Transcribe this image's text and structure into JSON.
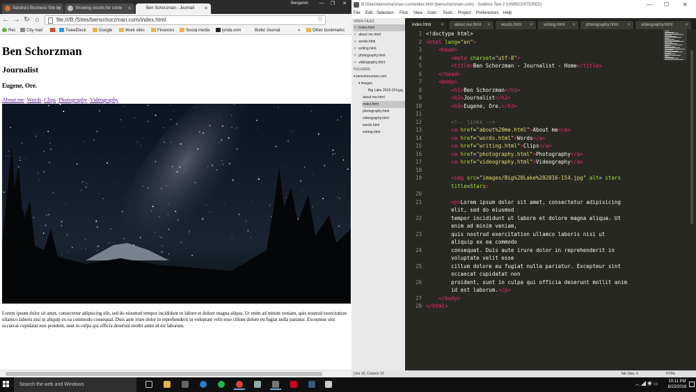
{
  "chrome": {
    "tabs": [
      {
        "label": "Sandra's Business Site by"
      },
      {
        "label": "Showing results for conte"
      },
      {
        "label": "Ben Schorzman - Journali"
      }
    ],
    "user": "Benjamin",
    "address": "file:///B:/Sites/benschorzman.com/index.html",
    "bookmarks": [
      "Rec",
      "City mail",
      "TweetDeck",
      "Google",
      "Work sites",
      "Finances",
      "Social media",
      "lynda.com",
      "Bullet Journal",
      "Other bookmarks"
    ]
  },
  "site": {
    "h1": "Ben Schorzman",
    "h2": "Journalist",
    "h3": "Eugene, Ore.",
    "links": [
      "About me",
      "Words",
      "Clips",
      "Photography",
      "Videography"
    ],
    "paragraph": "Lorem ipsum dolor sit amet, consectetur adipiscing elit, sed do eiusmod tempor incididunt ut labore et dolore magna aliqua. Ut enim ad minim veniam, quis nostrud exercitation ullamco laboris nisi ut aliquip ex ea commodo consequat. Duis aute irure dolor in reprehenderit in voluptate velit esse cillum dolore eu fugiat nulla pariatur. Excepteur sint occaecat cupidatat non proident, sunt in culpa qui officia deserunt mollit anim id est laborum."
  },
  "sublime": {
    "title": "B:\\Sites\\benschorzman.com\\index.html (benschorzman.com) - Sublime Text 2 (UNREGISTERED)",
    "menu": [
      "File",
      "Edit",
      "Selection",
      "Find",
      "View",
      "Goto",
      "Tools",
      "Project",
      "Preferences",
      "Help"
    ],
    "open_files_heading": "OPEN FILES",
    "open_files": [
      "index.html",
      "about me.html",
      "words.html",
      "writing.html",
      "photography.html",
      "videography.html"
    ],
    "folders_heading": "FOLDERS",
    "folder_tree": [
      "benschorzman.com",
      "images",
      "Big Lake 2016-154.jpg",
      "about me.html",
      "index.html",
      "photography.html",
      "videography.html",
      "words.html",
      "writing.html"
    ],
    "tabs": [
      "index.html",
      "about me.html",
      "words.html",
      "writing.html",
      "photography.html",
      "videography.html"
    ],
    "line_numbers": [
      "1",
      "2",
      "3",
      "4",
      "5",
      "6",
      "7",
      "8",
      "9",
      "10",
      "11",
      "12",
      "13",
      "14",
      "15",
      "16",
      "17",
      "18",
      "19",
      "",
      "20",
      "21",
      "",
      "22",
      "",
      "23",
      "",
      "24",
      "",
      "25",
      "",
      "26",
      "",
      "27",
      "28"
    ],
    "status_left": "Line 10, Column 13",
    "status_tab": "Tab Size: 4",
    "status_syntax": "HTML"
  },
  "taskbar": {
    "search_placeholder": "Search the web and Windows",
    "time": "10:11 PM",
    "date": "8/23/2016"
  }
}
